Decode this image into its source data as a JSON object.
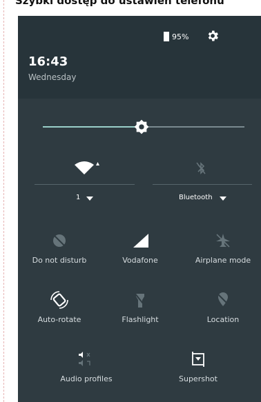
{
  "page_title": "Szybki dostęp do ustawień telefonu",
  "status_bar": {
    "battery_percent": "95%"
  },
  "header": {
    "time": "16:43",
    "day": "Wednesday"
  },
  "brightness": {
    "level": 0.49
  },
  "wifi": {
    "network": "1"
  },
  "bluetooth": {
    "label": "Bluetooth"
  },
  "tiles": {
    "dnd": "Do not disturb",
    "vodafone": "Vodafone",
    "airplane": "Airplane mode",
    "autorotate": "Auto-rotate",
    "flashlight": "Flashlight",
    "location": "Location",
    "audio_profiles": "Audio profiles",
    "supershot": "Supershot"
  },
  "colors": {
    "panel": "#2f3b41",
    "accent": "#9ad0ca",
    "dim_icon": "#66747a"
  }
}
